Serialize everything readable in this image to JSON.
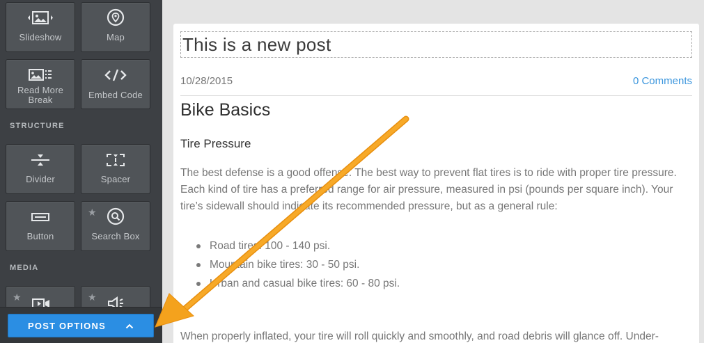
{
  "sidebar": {
    "top_tiles": [
      {
        "label": "Slideshow",
        "icon": "slideshow-icon"
      },
      {
        "label": "Map",
        "icon": "map-pin-icon"
      },
      {
        "label": "Read More Break",
        "icon": "read-more-icon"
      },
      {
        "label": "Embed Code",
        "icon": "embed-code-icon"
      }
    ],
    "structure_title": "STRUCTURE",
    "structure_tiles": [
      {
        "label": "Divider",
        "icon": "divider-icon"
      },
      {
        "label": "Spacer",
        "icon": "spacer-icon"
      },
      {
        "label": "Button",
        "icon": "button-icon"
      },
      {
        "label": "Search Box",
        "icon": "search-icon",
        "starred": true
      }
    ],
    "media_title": "MEDIA",
    "media_tiles": [
      {
        "icon": "video-icon",
        "starred": true
      },
      {
        "icon": "audio-icon",
        "starred": true
      }
    ],
    "star_glyph": "★",
    "post_options_label": "POST OPTIONS",
    "post_options_chevron": "^"
  },
  "post": {
    "title": "This is a new post",
    "date": "10/28/2015",
    "comments": "0 Comments",
    "heading": "Bike Basics",
    "subheading": "Tire Pressure",
    "paragraph_1": "The best defense is a good offense. The best way to prevent flat tires is to ride with proper tire pressure. Each kind of tire has a preferred range for air pressure, measured in psi (pounds per square inch). Your tire’s sidewall should indicate its recommended pressure, but as a general rule:",
    "list": [
      "Road tires: 100 - 140 psi.",
      "Mountain bike tires: 30 - 50 psi.",
      "Urban and casual bike tires: 60 - 80 psi."
    ],
    "paragraph_2": "When properly inflated, your tire will roll quickly and smoothly, and road debris will glance off. Under-"
  },
  "colors": {
    "sidebar_bg": "#3d4044",
    "tile_bg": "#505458",
    "accent_blue": "#2b8ee3",
    "arrow_orange": "#f4a21d",
    "link_blue": "#3a95dd"
  }
}
